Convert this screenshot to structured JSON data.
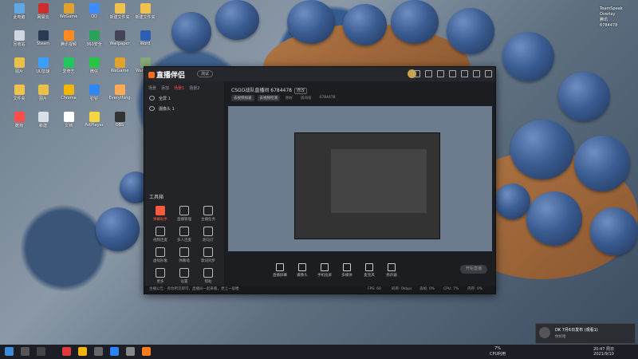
{
  "desktop_icons": [
    {
      "label": "此电脑",
      "color": "#5fa8e8"
    },
    {
      "label": "回收站",
      "color": "#cfd6df"
    },
    {
      "label": "图片",
      "color": "#e8c04a"
    },
    {
      "label": "文件夹",
      "color": "#f0c24c"
    },
    {
      "label": "酷狗",
      "color": "#ff4b4b"
    },
    {
      "label": "网易云",
      "color": "#cf2d2d"
    },
    {
      "label": "Steam",
      "color": "#2a3a55"
    },
    {
      "label": "UU加速",
      "color": "#3aa0ff"
    },
    {
      "label": "图片",
      "color": "#e8c04a"
    },
    {
      "label": "新建",
      "color": "#d9dfe6"
    },
    {
      "label": "WeGame",
      "color": "#e0a12d"
    },
    {
      "label": "腾讯视频",
      "color": "#ff8a20"
    },
    {
      "label": "爱奇艺",
      "color": "#1ec85a"
    },
    {
      "label": "Chrome",
      "color": "#f0b600"
    },
    {
      "label": "文档",
      "color": "#fff"
    },
    {
      "label": "QQ",
      "color": "#3c8dff"
    },
    {
      "label": "360安全",
      "color": "#2aa35a"
    },
    {
      "label": "微信",
      "color": "#28c445"
    },
    {
      "label": "钉钉",
      "color": "#2d87f5"
    },
    {
      "label": "PotPlayer",
      "color": "#f5d640"
    },
    {
      "label": "新建文件夹",
      "color": "#f0c24c"
    },
    {
      "label": "Wallpaper",
      "color": "#445"
    },
    {
      "label": "WeGame",
      "color": "#e0a12d"
    },
    {
      "label": "Everything",
      "color": "#fa5"
    },
    {
      "label": "OBS",
      "color": "#333"
    },
    {
      "label": "新建文件夹",
      "color": "#f0c24c"
    },
    {
      "label": "Word",
      "color": "#2b5fb4"
    },
    {
      "label": "Wargame",
      "color": "#8a7"
    }
  ],
  "right_card": {
    "line1": "TeamSpeak",
    "line2": "Overlay",
    "line3": "腾讯",
    "line4": "6784478"
  },
  "app": {
    "logo": "直播伴侣",
    "badge": "测试",
    "sidebar": {
      "tabs": [
        "场景",
        "添加",
        "场景1",
        "场景2"
      ],
      "scenes": [
        "全屏 1",
        "摄像头 1"
      ],
      "tools_title": "工具箱",
      "tools": [
        {
          "label": "弹幕助手",
          "active": true
        },
        {
          "label": "直播管理",
          "active": false
        },
        {
          "label": "主播任务",
          "active": false
        },
        {
          "label": "视频连麦",
          "active": false
        },
        {
          "label": "多人连麦",
          "active": false
        },
        {
          "label": "跑马灯",
          "active": false
        },
        {
          "label": "虚拟形象",
          "active": false
        },
        {
          "label": "弹幕墙",
          "active": false
        },
        {
          "label": "歌词同步",
          "active": false
        },
        {
          "label": "更多",
          "active": false
        },
        {
          "label": "设置",
          "active": false
        },
        {
          "label": "帮助",
          "active": false
        }
      ]
    },
    "room": {
      "title": "CSGO战队直播间 6784478",
      "edit": "修改"
    },
    "chips": [
      "去视频加速",
      "去视频检测",
      "你好",
      "房间号",
      "6784478"
    ],
    "bottom": [
      {
        "label": "直播屏幕"
      },
      {
        "label": "摄像头"
      },
      {
        "label": "手机投屏"
      },
      {
        "label": "多媒体"
      },
      {
        "label": "麦克风"
      },
      {
        "label": "扬声器"
      }
    ],
    "start_label": "开始直播",
    "status": {
      "notice": "主播公告：有你所见即可，直播间一起来看，更上一层楼",
      "items": [
        "FPS: 60",
        "码率: 0kbps",
        "丢帧: 0%",
        "CPU: 7%",
        "内存: 0%"
      ]
    }
  },
  "toast": {
    "line1": "DK 7月6日发布 (观看1)",
    "line2": "你好哈"
  },
  "tray": {
    "cpu": "7%",
    "cpu_label": "CPU利用",
    "time": "20:47 周日",
    "date": "2021/9/10"
  }
}
